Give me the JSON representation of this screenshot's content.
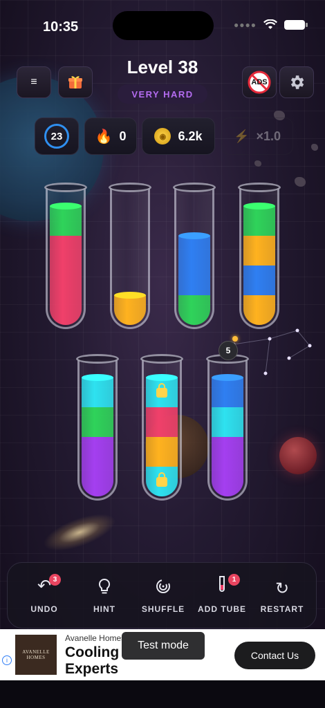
{
  "status_bar": {
    "time": "10:35"
  },
  "header": {
    "title": "Level 38",
    "difficulty": "VERY HARD",
    "menu_icon": "hamburger-menu-icon",
    "gift_icon": "gift-icon",
    "ads_icon": "no-ads-icon",
    "ads_label": "ADS",
    "settings_icon": "gear-icon"
  },
  "stats": {
    "moves": "23",
    "streak": "0",
    "coins": "6.2k",
    "multiplier": "×1.0"
  },
  "colors": {
    "green": "#2fd35a",
    "red": "#f0406a",
    "blue": "#2f7ff2",
    "yellow": "#ffb21f",
    "cyan": "#2ee2f0",
    "purple": "#a43ff0"
  },
  "tubes": [
    {
      "layers": [
        "red",
        "red",
        "red",
        "green"
      ]
    },
    {
      "layers": [
        "yellow"
      ]
    },
    {
      "layers": [
        "green",
        "blue",
        "blue"
      ]
    },
    {
      "layers": [
        "yellow",
        "blue",
        "yellow",
        "green"
      ]
    },
    {
      "layers": [
        "purple",
        "purple",
        "green",
        "cyan"
      ]
    },
    {
      "layers": [
        "cyan",
        "yellow",
        "red",
        "cyan"
      ],
      "locked": [
        0,
        3
      ]
    },
    {
      "layers": [
        "purple",
        "purple",
        "cyan",
        "blue"
      ],
      "bomb": "5"
    }
  ],
  "toolbar": {
    "undo": {
      "label": "UNDO",
      "badge": "3"
    },
    "hint": {
      "label": "HINT"
    },
    "shuffle": {
      "label": "SHUFFLE"
    },
    "add_tube": {
      "label": "ADD TUBE",
      "badge": "1"
    },
    "restart": {
      "label": "RESTART"
    }
  },
  "ad": {
    "logo_line1": "AVANELLE",
    "logo_line2": "HOMES",
    "brand": "Avanelle Homes",
    "headline": "Cooling Experts",
    "toast": "Test mode",
    "cta": "Contact Us",
    "info": "i"
  }
}
